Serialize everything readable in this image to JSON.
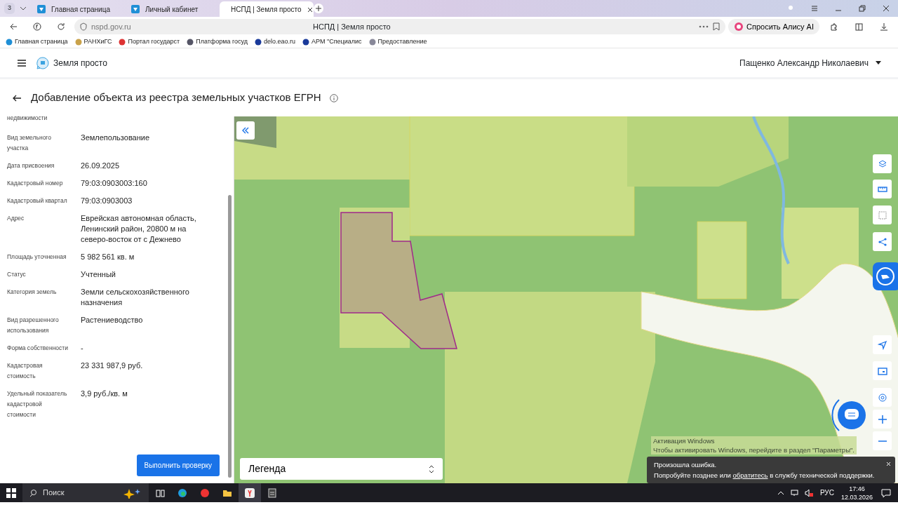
{
  "browser": {
    "tab_count": "3",
    "tabs": [
      {
        "title": "Главная страница",
        "selected": false
      },
      {
        "title": "Личный кабинет",
        "selected": false
      },
      {
        "title": "НСПД | Земля просто",
        "selected": true
      }
    ],
    "address": "nspd.gov.ru",
    "page_title": "НСПД | Земля просто",
    "alice_button": "Спросить Алису AI",
    "bookmarks": [
      "Главная страница",
      "РАНХиГС",
      "Портал государст",
      "Платформа госуд",
      "delo.eao.ru",
      "АРМ \"Специалис",
      "Предоставление"
    ]
  },
  "app": {
    "logo_text": "Земля просто",
    "user_name": "Пащенко Александр Николаевич",
    "page_title": "Добавление объекта из реестра земельных участков ЕГРН"
  },
  "details": {
    "cut_label": "недвижимости",
    "rows": [
      {
        "label": "Вид земельного участка",
        "value": "Землепользование"
      },
      {
        "label": "Дата присвоения",
        "value": "26.09.2025"
      },
      {
        "label": "Кадастровый номер",
        "value": "79:03:0903003:160"
      },
      {
        "label": "Кадастровый квартал",
        "value": "79:03:0903003"
      },
      {
        "label": "Адрес",
        "value": "Еврейская автономная область, Ленинский район, 20800 м на северо-восток от с Дежнево"
      },
      {
        "label": "Площадь уточненная",
        "value": "5 982 561 кв. м"
      },
      {
        "label": "Статус",
        "value": "Учтенный"
      },
      {
        "label": "Категория земель",
        "value": "Земли сельскохозяйственного назначения"
      },
      {
        "label": "Вид разрешенного использования",
        "value": "Растениеводство"
      },
      {
        "label": "Форма собственности",
        "value": "-"
      },
      {
        "label": "Кадастровая стоимость",
        "value": "23 331 987,9 руб."
      },
      {
        "label": "Удельный показатель кадастровой стоимости",
        "value": "3,9 руб./кв. м"
      }
    ],
    "check_button": "Выполнить проверку"
  },
  "map": {
    "legend": "Легенда"
  },
  "activation": {
    "title": "Активация Windows",
    "text": "Чтобы активировать Windows, перейдите в раздел \"Параметры\"."
  },
  "error_toast": {
    "title": "Произошла ошибка.",
    "text_before": "Попробуйте позднее или",
    "link": "обратитесь",
    "text_after": "в службу технической поддержки."
  },
  "taskbar": {
    "search": "Поиск",
    "language": "РУС",
    "time": "17:46",
    "date": "12.03.2026"
  }
}
